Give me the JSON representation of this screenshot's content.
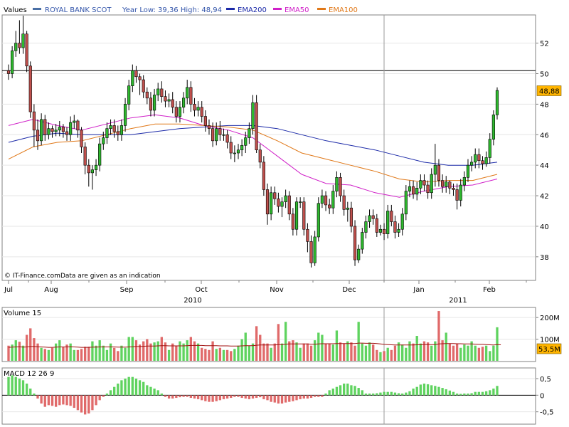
{
  "header": {
    "values_label": "Values",
    "legend": [
      {
        "name": "ROYAL BANK SCOT",
        "color": "#4a6fa5"
      },
      {
        "name": "Year Low: 39,36 High: 48,94",
        "color": null
      },
      {
        "name": "EMA200",
        "color": "#1c2aa8"
      },
      {
        "name": "EMA50",
        "color": "#d020c8"
      },
      {
        "name": "EMA100",
        "color": "#e07818"
      }
    ]
  },
  "footer_note": "© IT-Finance.comData are given as an indication",
  "price_panel": {
    "ylim": [
      36.5,
      53.8
    ],
    "ticks": [
      "38",
      "40",
      "42",
      "44",
      "46",
      "48",
      "50",
      "52"
    ],
    "tick_values": [
      38,
      40,
      42,
      44,
      46,
      48,
      50,
      52
    ],
    "reference_line": 50.2,
    "last_price_label": "48,88",
    "last_price": 48.88
  },
  "time_axis": {
    "months": [
      "Jul",
      "Aug",
      "Sep",
      "Oct",
      "Nov",
      "Dec",
      "Jan",
      "Feb"
    ],
    "years": [
      "2010",
      "2011"
    ]
  },
  "volume_panel": {
    "title": "Volume 15",
    "ylim": [
      0,
      240
    ],
    "ticks": [
      "100M",
      "200M"
    ],
    "tick_values": [
      100,
      200
    ],
    "last_label": "53,5M"
  },
  "macd_panel": {
    "title": "MACD 12 26 9",
    "ylim": [
      -0.85,
      0.8
    ],
    "ticks": [
      "0,5",
      "0",
      "-0,5"
    ],
    "tick_values": [
      0.5,
      0,
      -0.5
    ]
  },
  "chart_data": {
    "type": "candlestick",
    "title": "ROYAL BANK SCOT",
    "series": [
      {
        "name": "ROYAL BANK SCOT",
        "kind": "ohlc",
        "open": [
          50.2,
          50.0,
          51.5,
          52.0,
          51.7,
          52.6,
          50.5,
          47.5,
          46.3,
          45.6,
          47.0,
          46.0,
          46.4,
          46.2,
          46.3,
          46.5,
          46.2,
          46.0,
          46.8,
          46.9,
          46.3,
          45.2,
          44.0,
          43.5,
          43.7,
          44.0,
          45.4,
          45.8,
          46.4,
          46.6,
          46.2,
          46.0,
          46.6,
          48.0,
          49.2,
          50.2,
          49.8,
          49.6,
          48.8,
          48.4,
          47.6,
          48.6,
          49.0,
          48.5,
          48.2,
          48.3,
          47.8,
          47.2,
          47.8,
          48.4,
          49.1,
          48.0,
          47.6,
          47.8,
          47.2,
          46.6,
          46.4,
          45.6,
          46.4,
          46.0,
          46.0,
          45.5,
          44.8,
          44.8,
          45.0,
          45.3,
          45.8,
          46.4,
          48.1,
          45.0,
          44.2,
          42.4,
          40.8,
          42.2,
          41.8,
          41.3,
          41.6,
          42.0,
          40.8,
          39.8,
          41.6,
          41.6,
          39.8,
          39.0,
          37.6,
          39.3,
          41.5,
          42.0,
          41.4,
          41.2,
          42.3,
          43.2,
          42.0,
          41.1,
          41.2,
          40.0,
          37.8,
          38.5,
          39.6,
          40.3,
          40.7,
          40.5,
          39.6,
          39.8,
          39.5,
          41.0,
          40.3,
          39.6,
          39.8,
          40.8,
          42.3,
          42.6,
          42.1,
          42.5,
          43.0,
          42.7,
          42.2,
          43.4,
          44.0,
          43.0,
          42.6,
          42.9,
          42.5,
          42.4,
          41.7,
          42.7,
          43.2,
          44.0,
          44.2,
          44.7,
          44.3,
          44.1,
          44.5,
          45.7,
          47.3
        ],
        "close": [
          50.0,
          51.5,
          52.0,
          51.7,
          52.6,
          50.5,
          47.5,
          46.3,
          45.6,
          47.0,
          46.0,
          46.4,
          46.2,
          46.3,
          46.5,
          46.2,
          46.0,
          46.8,
          46.9,
          46.3,
          45.2,
          44.0,
          43.5,
          43.7,
          44.0,
          45.4,
          45.8,
          46.4,
          46.6,
          46.2,
          46.0,
          46.6,
          48.0,
          49.2,
          50.2,
          49.8,
          49.6,
          48.8,
          48.4,
          47.6,
          48.6,
          49.0,
          48.5,
          48.2,
          48.3,
          47.8,
          47.2,
          47.8,
          48.4,
          49.1,
          48.0,
          47.6,
          47.8,
          47.2,
          46.6,
          46.4,
          45.6,
          46.4,
          46.0,
          46.0,
          45.5,
          44.8,
          44.8,
          45.0,
          45.3,
          45.8,
          46.4,
          48.1,
          45.0,
          44.2,
          42.4,
          40.8,
          42.2,
          41.8,
          41.3,
          41.6,
          42.0,
          40.8,
          39.8,
          41.6,
          41.6,
          39.8,
          39.0,
          37.6,
          39.3,
          41.5,
          42.0,
          41.4,
          41.2,
          42.3,
          43.2,
          42.0,
          41.1,
          41.2,
          40.0,
          37.8,
          38.5,
          39.6,
          40.3,
          40.7,
          40.5,
          39.6,
          39.8,
          39.5,
          41.0,
          40.3,
          39.6,
          39.8,
          40.8,
          42.3,
          42.6,
          42.1,
          42.5,
          43.0,
          42.7,
          42.2,
          43.4,
          44.0,
          43.0,
          42.6,
          42.9,
          42.5,
          42.4,
          41.7,
          42.7,
          43.2,
          44.0,
          44.2,
          44.7,
          44.3,
          44.1,
          44.5,
          45.7,
          47.3,
          48.9
        ],
        "high": [
          50.6,
          51.8,
          52.8,
          53.5,
          53.8,
          52.8,
          50.8,
          48.0,
          47.0,
          47.4,
          47.3,
          46.8,
          46.6,
          46.7,
          46.9,
          46.7,
          46.5,
          47.2,
          47.3,
          47.0,
          46.5,
          45.5,
          44.4,
          44.0,
          44.4,
          45.8,
          46.2,
          46.8,
          47.0,
          47.0,
          46.6,
          47.0,
          48.4,
          49.6,
          50.6,
          50.5,
          50.0,
          49.9,
          49.1,
          48.8,
          49.0,
          49.4,
          49.5,
          48.9,
          48.7,
          48.8,
          48.2,
          48.2,
          48.8,
          49.6,
          49.5,
          48.4,
          48.2,
          48.2,
          47.6,
          47.0,
          46.8,
          46.8,
          46.9,
          46.4,
          46.3,
          45.9,
          45.3,
          45.4,
          45.7,
          46.2,
          46.8,
          48.6,
          48.6,
          45.4,
          44.6,
          42.8,
          42.6,
          42.6,
          42.2,
          41.9,
          42.4,
          42.3,
          41.2,
          41.9,
          41.9,
          41.9,
          40.2,
          39.4,
          39.7,
          41.9,
          42.4,
          42.3,
          41.8,
          42.7,
          43.6,
          43.5,
          42.4,
          41.6,
          41.6,
          40.4,
          38.8,
          39.9,
          40.7,
          41.1,
          41.1,
          40.8,
          40.1,
          40.2,
          41.4,
          41.4,
          40.7,
          40.2,
          41.2,
          42.7,
          43.0,
          43.0,
          42.9,
          43.4,
          43.4,
          43.0,
          43.8,
          45.4,
          44.4,
          43.4,
          43.3,
          43.0,
          42.8,
          42.8,
          43.1,
          43.6,
          44.4,
          44.6,
          45.1,
          45.1,
          44.6,
          44.9,
          46.1,
          47.6,
          49.1
        ],
        "low": [
          49.6,
          49.7,
          51.1,
          51.3,
          51.3,
          50.1,
          47.1,
          45.2,
          45.0,
          45.3,
          45.6,
          45.7,
          45.8,
          45.9,
          45.9,
          45.8,
          45.6,
          45.6,
          46.4,
          45.8,
          44.8,
          43.4,
          42.6,
          42.4,
          43.3,
          43.6,
          45.0,
          45.4,
          46.0,
          45.8,
          45.6,
          45.6,
          46.2,
          47.6,
          48.8,
          49.4,
          48.6,
          48.4,
          48.0,
          47.2,
          47.2,
          48.2,
          48.1,
          47.8,
          47.8,
          47.4,
          46.8,
          46.8,
          47.4,
          48.0,
          47.5,
          47.2,
          47.2,
          46.8,
          46.2,
          46.0,
          45.2,
          45.3,
          45.6,
          45.6,
          45.1,
          44.4,
          44.2,
          44.4,
          44.6,
          44.8,
          45.4,
          46.0,
          44.8,
          43.8,
          42.0,
          40.1,
          40.4,
          41.4,
          40.9,
          40.6,
          41.2,
          40.4,
          39.4,
          39.4,
          41.2,
          39.4,
          38.3,
          37.3,
          37.4,
          39.0,
          41.2,
          41.0,
          40.8,
          40.8,
          41.9,
          41.6,
          40.7,
          40.3,
          39.6,
          37.4,
          37.6,
          38.2,
          39.2,
          39.9,
          40.1,
          39.3,
          39.4,
          39.1,
          39.2,
          40.0,
          39.2,
          39.3,
          39.4,
          40.4,
          41.9,
          41.8,
          41.7,
          42.1,
          42.3,
          41.8,
          41.8,
          42.6,
          42.6,
          42.2,
          42.2,
          42.1,
          42.0,
          41.1,
          41.3,
          42.3,
          42.9,
          43.6,
          43.8,
          43.8,
          43.7,
          43.9,
          44.1,
          45.3,
          47.0
        ]
      },
      {
        "name": "EMA200",
        "color": "#1c2aa8",
        "x_frac": [
          0,
          0.05,
          0.1,
          0.15,
          0.2,
          0.25,
          0.3,
          0.35,
          0.4,
          0.45,
          0.5,
          0.55,
          0.6,
          0.65,
          0.7,
          0.75,
          0.8,
          0.85,
          0.9,
          0.95,
          1.0
        ],
        "values": [
          45.5,
          45.9,
          46.1,
          46.0,
          46.0,
          46.0,
          46.2,
          46.4,
          46.5,
          46.6,
          46.6,
          46.4,
          46.0,
          45.6,
          45.3,
          45.0,
          44.6,
          44.2,
          44.0,
          44.0,
          44.2
        ]
      },
      {
        "name": "EMA50",
        "color": "#d020c8",
        "x_frac": [
          0,
          0.05,
          0.1,
          0.15,
          0.2,
          0.25,
          0.3,
          0.35,
          0.4,
          0.45,
          0.5,
          0.55,
          0.6,
          0.65,
          0.7,
          0.75,
          0.8,
          0.85,
          0.9,
          0.95,
          1.0
        ],
        "values": [
          46.6,
          47.0,
          46.6,
          46.3,
          46.7,
          47.1,
          47.3,
          47.1,
          46.6,
          46.3,
          45.8,
          44.6,
          43.4,
          42.8,
          42.7,
          42.2,
          41.9,
          42.3,
          42.6,
          42.7,
          43.1
        ]
      },
      {
        "name": "EMA100",
        "color": "#e07818",
        "x_frac": [
          0,
          0.05,
          0.1,
          0.15,
          0.2,
          0.25,
          0.3,
          0.35,
          0.4,
          0.45,
          0.5,
          0.55,
          0.6,
          0.65,
          0.7,
          0.75,
          0.8,
          0.85,
          0.9,
          0.95,
          1.0
        ],
        "values": [
          44.4,
          45.2,
          45.5,
          45.6,
          46.0,
          46.4,
          46.7,
          46.7,
          46.6,
          46.5,
          46.3,
          45.6,
          44.8,
          44.4,
          44.0,
          43.6,
          43.1,
          42.9,
          43.0,
          43.0,
          43.4
        ]
      },
      {
        "name": "Volume 15",
        "kind": "bars",
        "units": "M",
        "values": [
          70,
          75,
          95,
          88,
          70,
          120,
          150,
          105,
          80,
          60,
          55,
          50,
          60,
          80,
          95,
          65,
          75,
          80,
          50,
          50,
          55,
          65,
          65,
          90,
          70,
          95,
          70,
          50,
          80,
          60,
          45,
          70,
          60,
          110,
          110,
          95,
          75,
          90,
          100,
          80,
          85,
          90,
          110,
          85,
          50,
          80,
          70,
          90,
          80,
          95,
          110,
          90,
          80,
          60,
          55,
          50,
          90,
          55,
          60,
          50,
          50,
          45,
          55,
          70,
          100,
          130,
          70,
          80,
          160,
          120,
          80,
          80,
          60,
          80,
          170,
          80,
          180,
          90,
          95,
          85,
          60,
          80,
          80,
          70,
          95,
          130,
          120,
          80,
          80,
          75,
          140,
          85,
          80,
          90,
          85,
          70,
          180,
          80,
          70,
          85,
          75,
          50,
          40,
          45,
          60,
          50,
          70,
          85,
          75,
          60,
          90,
          80,
          115,
          80,
          90,
          85,
          70,
          90,
          230,
          95,
          130,
          80,
          70,
          80,
          60,
          75,
          70,
          90,
          70,
          60,
          65,
          70,
          45,
          70,
          155,
          60
        ],
        "ema": [
          62,
          63,
          64,
          65,
          63,
          64,
          66,
          66,
          65,
          64,
          63,
          62,
          62,
          63,
          64,
          64,
          64,
          65,
          64,
          63,
          62,
          62,
          62,
          63,
          63,
          64,
          64,
          64,
          64,
          64,
          63,
          63,
          63,
          64,
          65,
          66,
          66,
          67,
          68,
          68,
          68,
          69,
          70,
          70,
          69,
          69,
          69,
          69,
          69,
          70,
          71,
          71,
          71,
          71,
          70,
          70,
          70,
          70,
          69,
          69,
          69,
          68,
          68,
          68,
          69,
          70,
          70,
          70,
          72,
          73,
          73,
          73,
          73,
          73,
          75,
          75,
          77,
          78,
          78,
          78,
          78,
          78,
          78,
          77,
          77,
          78,
          79,
          79,
          79,
          79,
          80,
          80,
          80,
          80,
          80,
          80,
          82,
          82,
          81,
          81,
          81,
          80,
          78,
          76,
          75,
          74,
          73,
          73,
          73,
          73,
          73,
          73,
          74,
          74,
          75,
          75,
          75,
          75,
          78,
          79,
          80,
          80,
          80,
          79,
          79,
          78,
          78,
          78,
          77,
          76,
          76,
          75,
          74,
          73,
          75,
          74
        ]
      },
      {
        "name": "MACD 12 26 9",
        "kind": "histogram",
        "values": [
          0.55,
          0.6,
          0.55,
          0.5,
          0.45,
          0.35,
          0.2,
          0.05,
          -0.1,
          -0.25,
          -0.35,
          -0.3,
          -0.32,
          -0.35,
          -0.3,
          -0.28,
          -0.3,
          -0.32,
          -0.38,
          -0.45,
          -0.52,
          -0.58,
          -0.55,
          -0.45,
          -0.3,
          -0.15,
          -0.05,
          0.05,
          0.15,
          0.25,
          0.35,
          0.45,
          0.5,
          0.55,
          0.55,
          0.5,
          0.45,
          0.4,
          0.3,
          0.25,
          0.2,
          0.15,
          0.05,
          -0.05,
          -0.1,
          -0.1,
          -0.08,
          -0.06,
          -0.05,
          -0.05,
          -0.08,
          -0.1,
          -0.12,
          -0.15,
          -0.18,
          -0.2,
          -0.2,
          -0.18,
          -0.15,
          -0.12,
          -0.1,
          -0.08,
          -0.05,
          -0.05,
          -0.08,
          -0.1,
          -0.12,
          -0.1,
          -0.08,
          -0.06,
          -0.12,
          -0.15,
          -0.2,
          -0.22,
          -0.25,
          -0.25,
          -0.22,
          -0.2,
          -0.18,
          -0.15,
          -0.12,
          -0.1,
          -0.1,
          -0.08,
          -0.05,
          -0.05,
          -0.05,
          0.05,
          0.15,
          0.2,
          0.25,
          0.3,
          0.35,
          0.35,
          0.3,
          0.28,
          0.22,
          0.15,
          0.05,
          0.05,
          0.05,
          0.06,
          0.08,
          0.1,
          0.1,
          0.1,
          0.08,
          0.06,
          0.05,
          0.08,
          0.12,
          0.2,
          0.25,
          0.32,
          0.35,
          0.33,
          0.3,
          0.28,
          0.25,
          0.22,
          0.18,
          0.14,
          0.1,
          0.05,
          0.04,
          0.05,
          0.05,
          0.06,
          0.1,
          0.1,
          0.1,
          0.12,
          0.15,
          0.2,
          0.28,
          0.4
        ]
      }
    ]
  }
}
